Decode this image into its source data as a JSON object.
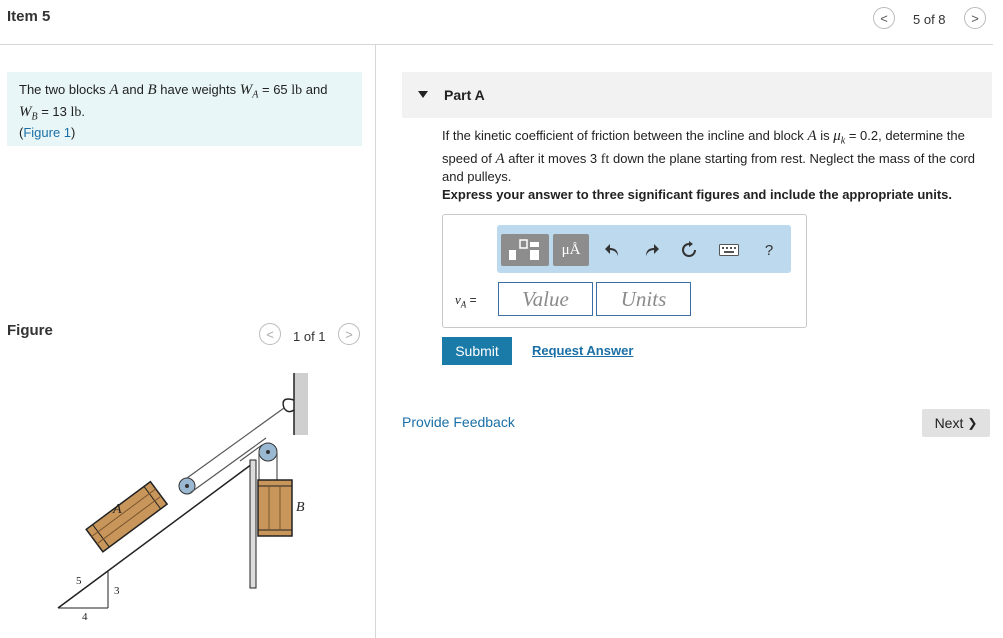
{
  "header": {
    "title": "Item 5",
    "pager_text": "5 of 8",
    "prev_glyph": "<",
    "next_glyph": ">"
  },
  "problem": {
    "intro": "The two blocks",
    "var_a": "A",
    "and1": "and",
    "var_b": "B",
    "weights_text": "have weights",
    "wa_symbol": "W",
    "wa_sub": "A",
    "wa_value": " = 65",
    "wa_unit": "lb",
    "and2": "and",
    "wb_symbol": "W",
    "wb_sub": "B",
    "wb_value": " = 13",
    "wb_unit": "lb",
    "wb_end": ".",
    "figure_open": "(",
    "figure_link": "Figure 1",
    "figure_close": ")"
  },
  "figure_panel": {
    "label": "Figure",
    "pager_text": "1 of 1",
    "prev_glyph": "<",
    "next_glyph": ">",
    "labels": {
      "block_a": "A",
      "block_b": "B",
      "slope_5": "5",
      "slope_3": "3",
      "slope_4": "4"
    }
  },
  "part": {
    "title": "Part A",
    "question_1": "If the kinetic coefficient of friction between the incline and block",
    "question_var_a": "A",
    "question_2": "is",
    "question_mu": "μ",
    "question_mu_sub": "k",
    "question_3": " = 0.2, determine the speed of",
    "question_var_a2": "A",
    "question_4": "after it moves 3",
    "question_unit": "ft",
    "question_5": "down the plane starting from rest. Neglect the mass of the cord and pulleys.",
    "instruction": "Express your answer to three significant figures and include the appropriate units."
  },
  "answer": {
    "label_symbol": "v",
    "label_sub": "A",
    "label_eq": " =",
    "value_placeholder": "Value",
    "units_placeholder": "Units",
    "toolbar": {
      "units_glyph": "μÅ",
      "help_glyph": "?"
    }
  },
  "actions": {
    "submit_label": "Submit",
    "request_label": "Request Answer",
    "feedback_label": "Provide Feedback",
    "next_label": "Next",
    "next_glyph": "❯"
  },
  "colors": {
    "accent": "#1a7aa8",
    "link": "#1a6fa6",
    "problem_bg": "#e8f6f7",
    "toolbar_bg": "#bcd9ee"
  }
}
